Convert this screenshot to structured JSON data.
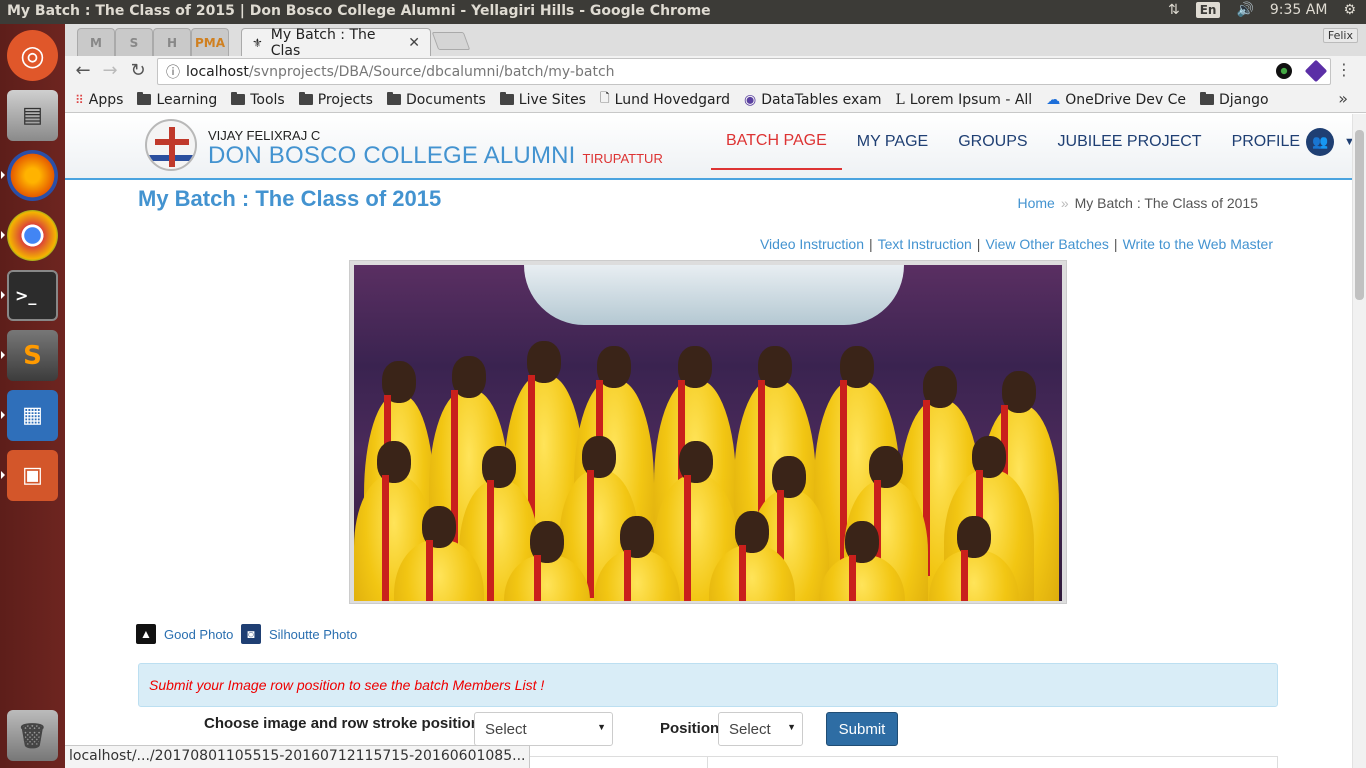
{
  "os": {
    "window_title": "My Batch : The Class of 2015 | Don Bosco College Alumni - Yellagiri Hills - Google Chrome",
    "keyboard": "En",
    "time": "9:35 AM"
  },
  "browser": {
    "profile": "Felix",
    "active_tab_title": "My Batch : The Clas",
    "url_host": "localhost",
    "url_path": "/svnprojects/DBA/Source/dbcalumni/batch/my-batch",
    "bookmarks": [
      {
        "label": "Apps",
        "icon": "apps-grid-icon"
      },
      {
        "label": "Learning",
        "icon": "folder-icon"
      },
      {
        "label": "Tools",
        "icon": "folder-icon"
      },
      {
        "label": "Projects",
        "icon": "folder-icon"
      },
      {
        "label": "Documents",
        "icon": "folder-icon"
      },
      {
        "label": "Live Sites",
        "icon": "folder-icon"
      },
      {
        "label": "Lund Hovedgard",
        "icon": "page-icon"
      },
      {
        "label": "DataTables exam",
        "icon": "globe-icon"
      },
      {
        "label": "Lorem Ipsum - All",
        "icon": "lorem-icon"
      },
      {
        "label": "OneDrive Dev Ce",
        "icon": "cloud-icon"
      },
      {
        "label": "Django",
        "icon": "folder-icon"
      }
    ],
    "status_url": "localhost/.../20170801105515-20160712115715-20160601085..."
  },
  "site": {
    "user_name": "VIJAY FELIXRAJ C",
    "college_name": "DON BOSCO COLLEGE ALUMNI",
    "college_town": "TIRUPATTUR",
    "nav": {
      "batch_page": "BATCH PAGE",
      "my_page": "MY PAGE",
      "groups": "GROUPS",
      "jubilee": "JUBILEE PROJECT",
      "profile": "PROFILE"
    }
  },
  "page": {
    "title": "My Batch : The Class of 2015",
    "breadcrumb_home": "Home",
    "breadcrumb_current": "My Batch : The Class of 2015",
    "links": {
      "video": "Video Instruction",
      "text": "Text Instruction",
      "other": "View Other Batches",
      "webmaster": "Write to the Web Master"
    },
    "photo_good": "Good Photo",
    "photo_silhouette": "Silhoutte Photo",
    "alert": "Submit your Image row position to see the batch Members List !",
    "form": {
      "choose_label": "Choose image and row stroke position",
      "choose_value": "Select",
      "position_label": "Position",
      "position_value": "Select",
      "submit": "Submit"
    }
  },
  "colors": {
    "accent": "#4393d0",
    "active_nav": "#dd3333",
    "nav_text": "#1f3f73",
    "alert_bg": "#d9edf7",
    "submit_bg": "#2e6da4",
    "launcher": "#6e2520"
  }
}
